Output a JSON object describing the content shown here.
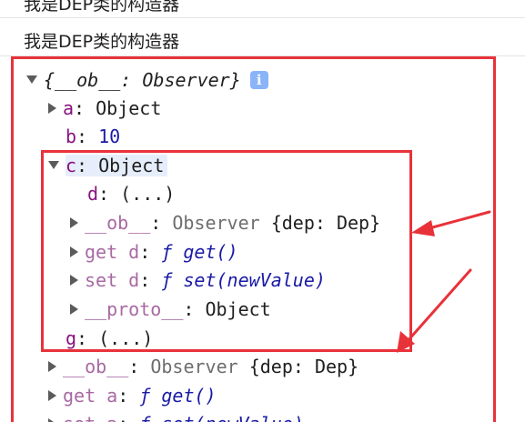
{
  "console": {
    "log_lines": [
      "我是DEP类的构造器",
      "我是DEP类的构造器"
    ],
    "tree": {
      "root_label": "{__ob__: Observer}",
      "info_icon": "i",
      "rows": {
        "a_key": "a",
        "a_value": "Object",
        "b_key": "b",
        "b_value": "10",
        "c_key": "c",
        "c_value": "Object",
        "d_key": "d",
        "d_value": "(...)",
        "c_ob_key": "__ob__",
        "c_ob_type": "Observer",
        "c_ob_value": "{dep: Dep}",
        "c_get_prefix": "get d",
        "c_get_fn": "ƒ get()",
        "c_set_prefix": "set d",
        "c_set_fn": "ƒ set(newValue)",
        "c_proto_key": "__proto__",
        "c_proto_value": "Object",
        "g_key": "g",
        "g_value": "(...)",
        "ob_key": "__ob__",
        "ob_type": "Observer",
        "ob_value": "{dep: Dep}",
        "get_a_prefix": "get a",
        "get_a_fn": "ƒ get()",
        "set_a_prefix": "set a",
        "set_a_fn": "ƒ set(newValue)"
      }
    }
  },
  "annotations": {
    "box_color": "#e8323a",
    "arrow_color": "#e8323a"
  }
}
